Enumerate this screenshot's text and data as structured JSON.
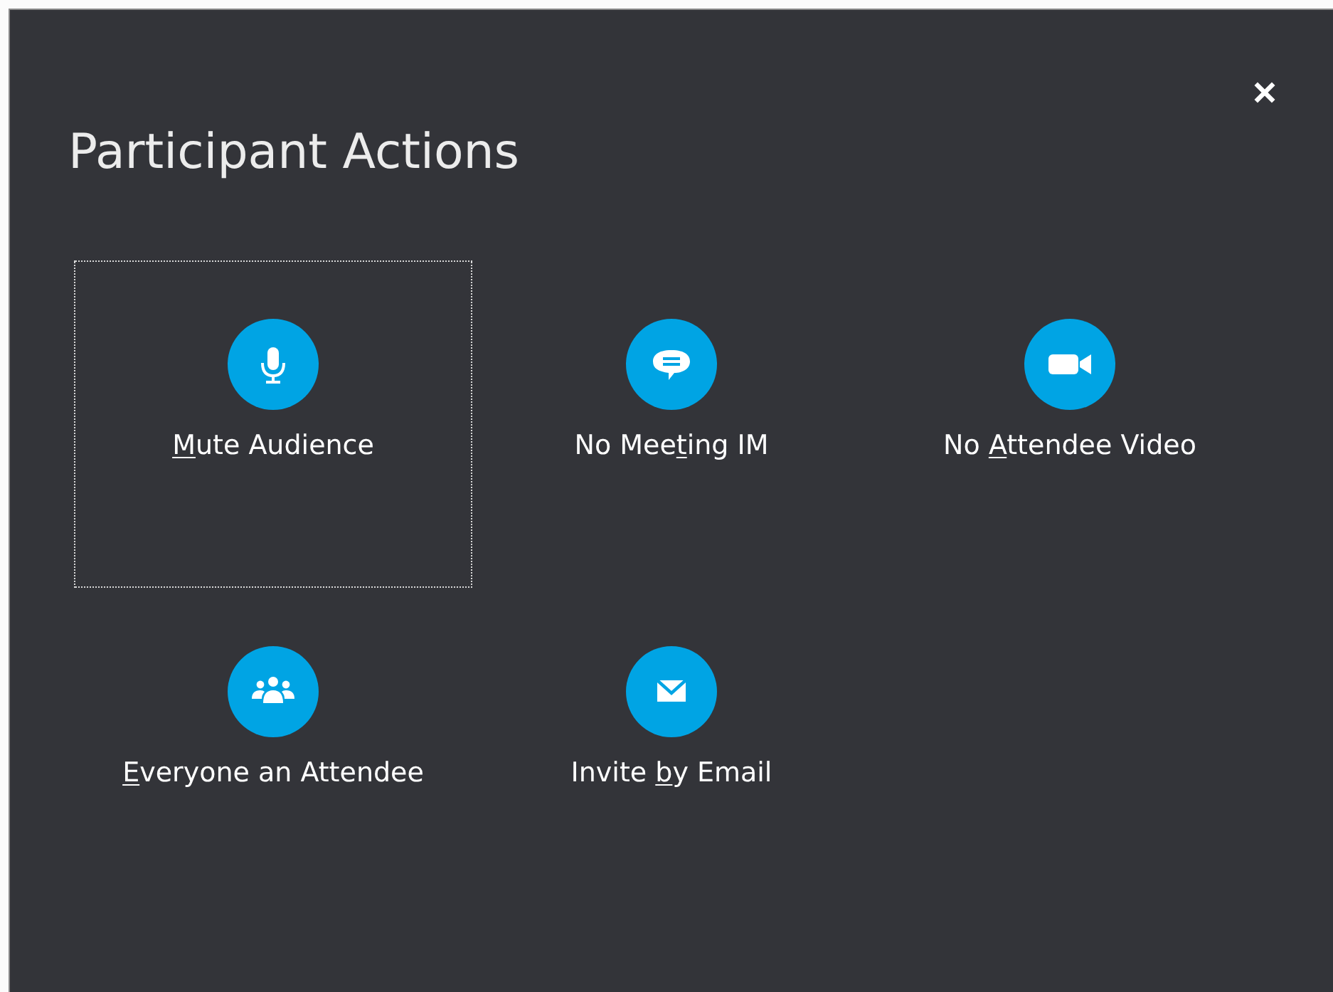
{
  "dialog": {
    "title": "Participant Actions"
  },
  "actions": [
    {
      "label": {
        "key": "M",
        "after": "ute Audience"
      },
      "focused": true
    },
    {
      "label": {
        "before": "No Mee",
        "key": "t",
        "after": "ing IM"
      },
      "focused": false
    },
    {
      "label": {
        "before": "No ",
        "key": "A",
        "after": "ttendee Video"
      },
      "focused": false
    },
    {
      "label": {
        "key": "E",
        "after": "veryone an Attendee"
      },
      "focused": false
    },
    {
      "label": {
        "before": "Invite ",
        "key": "b",
        "after": "y Email"
      },
      "focused": false
    }
  ]
}
